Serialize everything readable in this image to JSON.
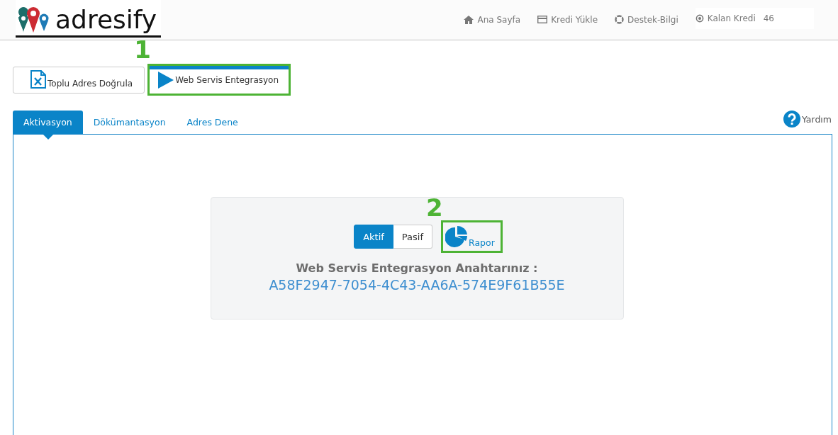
{
  "logo": {
    "text": "adresify"
  },
  "nav": [
    {
      "kind": "home",
      "label": "Ana Sayfa"
    },
    {
      "kind": "card",
      "label": "Kredi Yükle"
    },
    {
      "kind": "support",
      "label": "Destek-Bilgi"
    },
    {
      "kind": "credit",
      "label": "Kalan Kredi",
      "value": "46"
    }
  ],
  "modes": [
    {
      "kind": "excel",
      "label": "Toplu Adres Doğrula",
      "selected": false
    },
    {
      "kind": "play",
      "label": "Web Servis Entegrasyon",
      "selected": true,
      "highlight": "1"
    }
  ],
  "tabs": [
    {
      "label": "Aktivasyon",
      "selected": true
    },
    {
      "label": "Dökümantasyon",
      "selected": false
    },
    {
      "label": "Adres Dene",
      "selected": false
    }
  ],
  "help": {
    "label": "Yardım"
  },
  "toggle": [
    {
      "label": "Aktif",
      "selected": true
    },
    {
      "label": "Pasif",
      "selected": false
    }
  ],
  "report": {
    "label": "Rapor",
    "highlight": "2"
  },
  "key_label": "Web Servis Entegrasyon Anahtarınız :",
  "key_value": "A58F2947-7054-4C43-AA6A-574E9F61B55E"
}
